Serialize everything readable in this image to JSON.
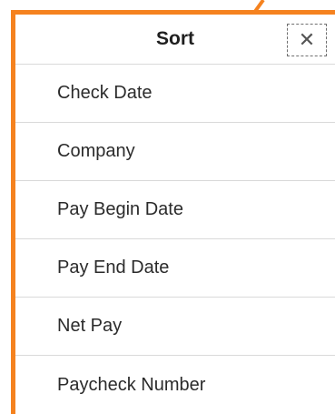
{
  "dialog": {
    "title": "Sort",
    "close_icon": "close-icon",
    "close_glyph": "✕"
  },
  "sort_options": [
    "Check Date",
    "Company",
    "Pay Begin Date",
    "Pay End Date",
    "Net Pay",
    "Paycheck Number"
  ],
  "colors": {
    "highlight": "#f5821f"
  }
}
